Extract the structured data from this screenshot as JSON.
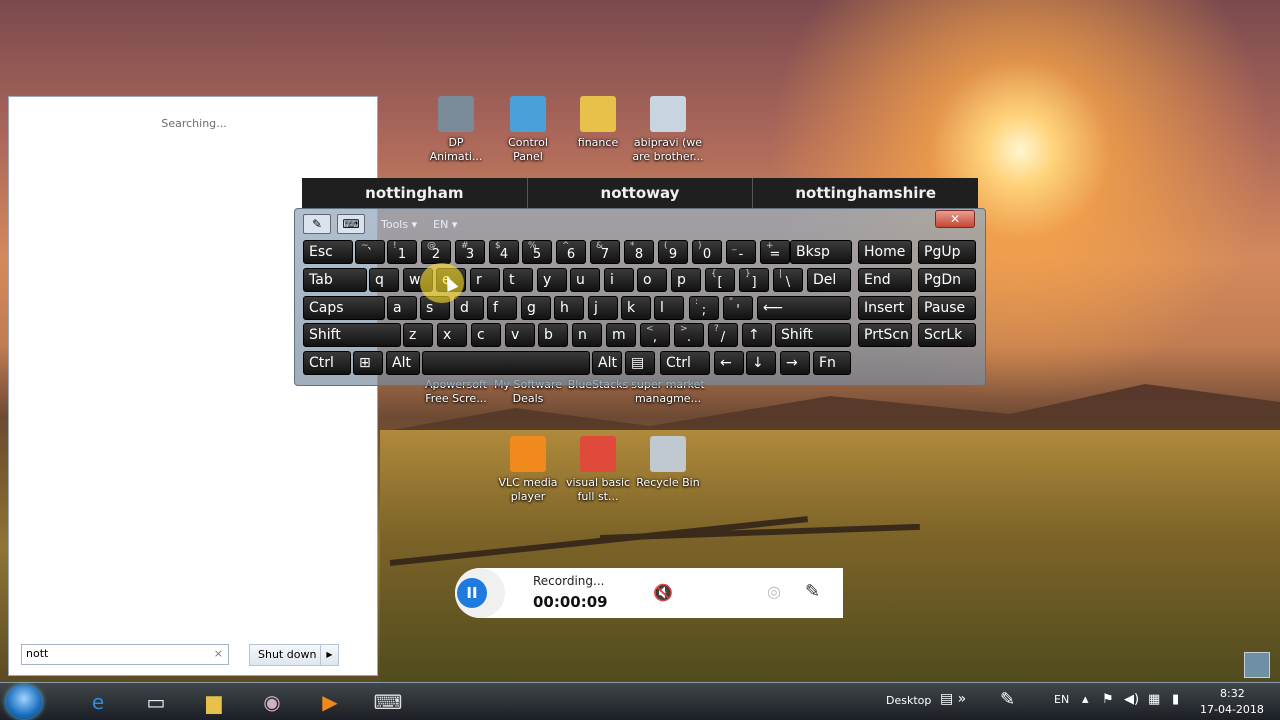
{
  "desktop": {
    "icons": [
      {
        "name": "dp-animati-icon",
        "label": "DP\nAnimati...",
        "color": "#7a8a96"
      },
      {
        "name": "control-panel-icon",
        "label": "Control\nPanel",
        "color": "#4aa0d8"
      },
      {
        "name": "finance-folder-icon",
        "label": "finance",
        "color": "#e8c14a"
      },
      {
        "name": "abipravi-icon",
        "label": "abipravi (we\nare brother...",
        "color": "#c8d4e0"
      },
      {
        "name": "apowersoft-icon",
        "label": "Apowersoft\nFree Scre...",
        "color": "#2c7bd6"
      },
      {
        "name": "mysoftware-deals-icon",
        "label": "My Software\nDeals",
        "color": "#3aa0e0"
      },
      {
        "name": "bluestacks-icon",
        "label": "BlueStacks",
        "color": "#47b04b"
      },
      {
        "name": "super-market-icon",
        "label": "super market\nmanagme...",
        "color": "#c8d4e0"
      },
      {
        "name": "vlc-icon",
        "label": "VLC media\nplayer",
        "color": "#f08a1c"
      },
      {
        "name": "chrome-icon",
        "label": "visual basic\nfull st...",
        "color": "#e04a3a"
      },
      {
        "name": "recycle-bin-icon",
        "label": "Recycle Bin",
        "color": "#c0c8d0"
      }
    ]
  },
  "start_menu": {
    "searching_text": "Searching...",
    "search_value": "nott",
    "clear_symbol": "×",
    "shutdown_label": "Shut down",
    "shutdown_arrow": "▶"
  },
  "suggestions": [
    "nottingham",
    "nottoway",
    "nottinghamshire"
  ],
  "osk": {
    "tools_label": "Tools",
    "lang_label": "EN",
    "close_symbol": "✕",
    "rows": [
      [
        [
          "Esc",
          ""
        ],
        [
          "`",
          "~"
        ],
        [
          "1",
          "!"
        ],
        [
          "2",
          "@"
        ],
        [
          "3",
          "#"
        ],
        [
          "4",
          "$"
        ],
        [
          "5",
          "%"
        ],
        [
          "6",
          "^"
        ],
        [
          "7",
          "&"
        ],
        [
          "8",
          "*"
        ],
        [
          "9",
          "("
        ],
        [
          "0",
          ")"
        ],
        [
          "-",
          "_"
        ],
        [
          "=",
          "+"
        ],
        [
          "Bksp",
          ""
        ],
        [
          "Home",
          ""
        ],
        [
          "PgUp",
          ""
        ]
      ],
      [
        [
          "Tab",
          ""
        ],
        [
          "q",
          ""
        ],
        [
          "w",
          ""
        ],
        [
          "e",
          ""
        ],
        [
          "r",
          ""
        ],
        [
          "t",
          ""
        ],
        [
          "y",
          ""
        ],
        [
          "u",
          ""
        ],
        [
          "i",
          ""
        ],
        [
          "o",
          ""
        ],
        [
          "p",
          ""
        ],
        [
          "[",
          "{"
        ],
        [
          "]",
          "}"
        ],
        [
          "\\",
          "|"
        ],
        [
          "Del",
          ""
        ],
        [
          "End",
          ""
        ],
        [
          "PgDn",
          ""
        ]
      ],
      [
        [
          "Caps",
          ""
        ],
        [
          "a",
          ""
        ],
        [
          "s",
          ""
        ],
        [
          "d",
          ""
        ],
        [
          "f",
          ""
        ],
        [
          "g",
          ""
        ],
        [
          "h",
          ""
        ],
        [
          "j",
          ""
        ],
        [
          "k",
          ""
        ],
        [
          "l",
          ""
        ],
        [
          ";",
          ":"
        ],
        [
          "'",
          "\""
        ],
        [
          "⟵",
          ""
        ],
        [
          "Insert",
          ""
        ],
        [
          "Pause",
          ""
        ]
      ],
      [
        [
          "Shift",
          ""
        ],
        [
          "z",
          ""
        ],
        [
          "x",
          ""
        ],
        [
          "c",
          ""
        ],
        [
          "v",
          ""
        ],
        [
          "b",
          ""
        ],
        [
          "n",
          ""
        ],
        [
          "m",
          ""
        ],
        [
          ",",
          "<"
        ],
        [
          ".",
          ">"
        ],
        [
          "/",
          "?"
        ],
        [
          "↑",
          ""
        ],
        [
          "Shift",
          ""
        ],
        [
          "PrtScn",
          ""
        ],
        [
          "ScrLk",
          ""
        ]
      ],
      [
        [
          "Ctrl",
          ""
        ],
        [
          "⊞",
          ""
        ],
        [
          "Alt",
          ""
        ],
        [
          "",
          ""
        ],
        [
          "Alt",
          ""
        ],
        [
          "▤",
          ""
        ],
        [
          "Ctrl",
          ""
        ],
        [
          "←",
          ""
        ],
        [
          "↓",
          ""
        ],
        [
          "→",
          ""
        ],
        [
          "Fn",
          ""
        ]
      ]
    ]
  },
  "recorder": {
    "pause_symbol": "II",
    "status": "Recording...",
    "time": "00:00:09",
    "audio_symbol": "🔇",
    "cam_symbol": "◎",
    "pen_symbol": "✎"
  },
  "taskbar": {
    "apps": [
      {
        "name": "ie-taskbar-icon",
        "glyph": "e",
        "color": "#2d8ae0"
      },
      {
        "name": "window-taskbar-icon",
        "glyph": "▭",
        "color": "#e8f0ff"
      },
      {
        "name": "explorer-taskbar-icon",
        "glyph": "▆",
        "color": "#e8c14a"
      },
      {
        "name": "paint-taskbar-icon",
        "glyph": "◉",
        "color": "#d0b0c8"
      },
      {
        "name": "media-taskbar-icon",
        "glyph": "▶",
        "color": "#f08a1c"
      },
      {
        "name": "osk-taskbar-icon",
        "glyph": "⌨",
        "color": "#e0e0e0"
      }
    ],
    "desktop_label": "Desktop",
    "lang": "EN",
    "time": "8:32",
    "date": "17-04-2018"
  }
}
